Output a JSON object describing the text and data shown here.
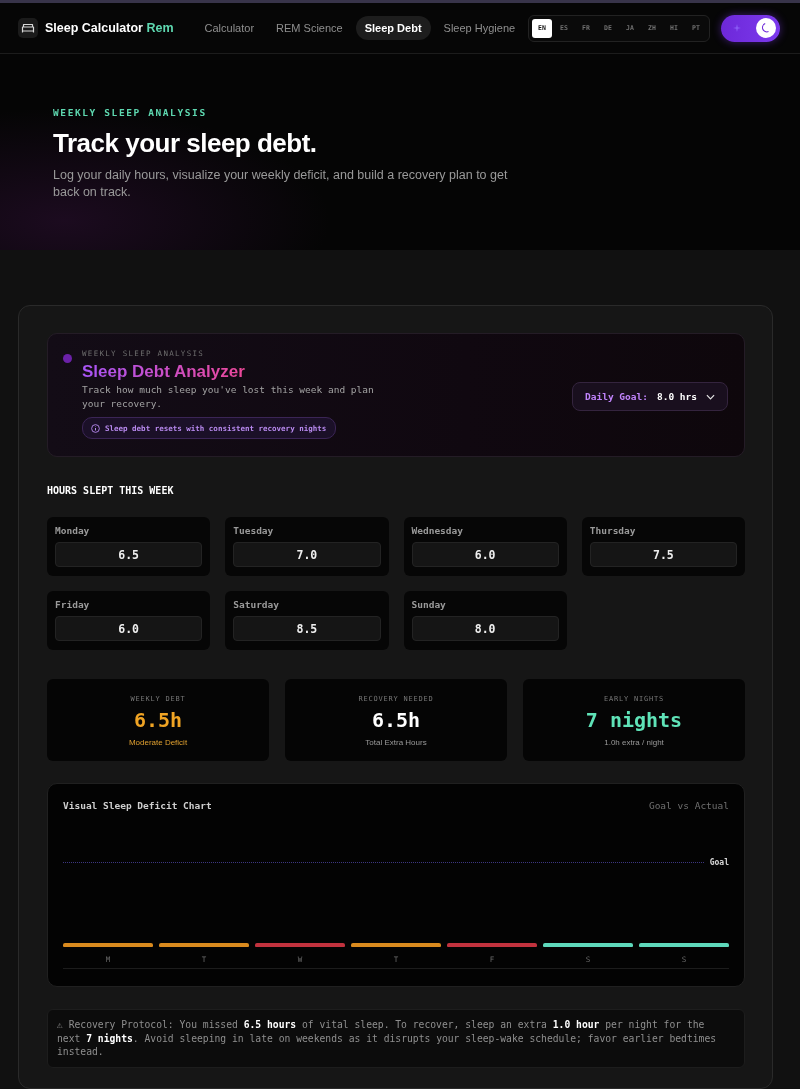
{
  "nav": {
    "brand": {
      "name": "Sleep Calculator",
      "accent": "Rem"
    },
    "links": [
      {
        "label": "Calculator",
        "selected": false
      },
      {
        "label": "REM Science",
        "selected": false
      },
      {
        "label": "Sleep Debt",
        "selected": true
      },
      {
        "label": "Sleep Hygiene",
        "selected": false
      }
    ],
    "languages": [
      {
        "label": "EN",
        "selected": true
      },
      {
        "label": "ES",
        "selected": false
      },
      {
        "label": "FR",
        "selected": false
      },
      {
        "label": "DE",
        "selected": false
      },
      {
        "label": "JA",
        "selected": false
      },
      {
        "label": "ZH",
        "selected": false
      },
      {
        "label": "HI",
        "selected": false
      },
      {
        "label": "PT",
        "selected": false
      }
    ],
    "theme_toggle": {
      "on": true
    }
  },
  "hero": {
    "eyebrow": "WEEKLY SLEEP ANALYSIS",
    "title": "Track your sleep debt.",
    "subtitle": "Log your daily hours, visualize your weekly deficit, and build a recovery plan to get back on track."
  },
  "analyzer": {
    "eyebrow": "WEEKLY SLEEP ANALYSIS",
    "title": "Sleep Debt Analyzer",
    "description": "Track how much sleep you've lost this week and plan your recovery.",
    "badge": "Sleep debt resets with consistent recovery nights",
    "goal_select": {
      "label": "Daily Goal:",
      "value": "8.0 hrs"
    }
  },
  "hours": {
    "heading": "HOURS SLEPT THIS WEEK",
    "days": [
      {
        "label": "Monday",
        "value": "6.5"
      },
      {
        "label": "Tuesday",
        "value": "7.0"
      },
      {
        "label": "Wednesday",
        "value": "6.0"
      },
      {
        "label": "Thursday",
        "value": "7.5"
      },
      {
        "label": "Friday",
        "value": "6.0"
      },
      {
        "label": "Saturday",
        "value": "8.5"
      },
      {
        "label": "Sunday",
        "value": "8.0"
      }
    ]
  },
  "stats": [
    {
      "label": "WEEKLY DEBT",
      "value": "6.5h",
      "caption": "Moderate Deficit",
      "kind": "warning"
    },
    {
      "label": "RECOVERY NEEDED",
      "value": "6.5h",
      "caption": "Total Extra Hours",
      "kind": "neutral"
    },
    {
      "label": "EARLY NIGHTS",
      "value": "7 nights",
      "caption": "1.0h extra / night",
      "kind": "success"
    }
  ],
  "chart": {
    "title": "Visual Sleep Deficit Chart",
    "legend": "Goal vs Actual",
    "goal_label": "Goal",
    "bars": [
      {
        "label": "M",
        "color": "#d98a1e"
      },
      {
        "label": "T",
        "color": "#d98a1e"
      },
      {
        "label": "W",
        "color": "#c2323e"
      },
      {
        "label": "T",
        "color": "#d98a1e"
      },
      {
        "label": "F",
        "color": "#c2323e"
      },
      {
        "label": "S",
        "color": "#5ed8bb"
      },
      {
        "label": "S",
        "color": "#5ed8bb"
      }
    ]
  },
  "note": "⚠ Recovery Protocol: You missed **6.5 hours** of vital sleep. To recover, sleep an extra **1.0 hour** per night for the next **7 nights**. Avoid sleeping in late on weekends as it disrupts your sleep-wake schedule; favor earlier bedtimes instead."
}
